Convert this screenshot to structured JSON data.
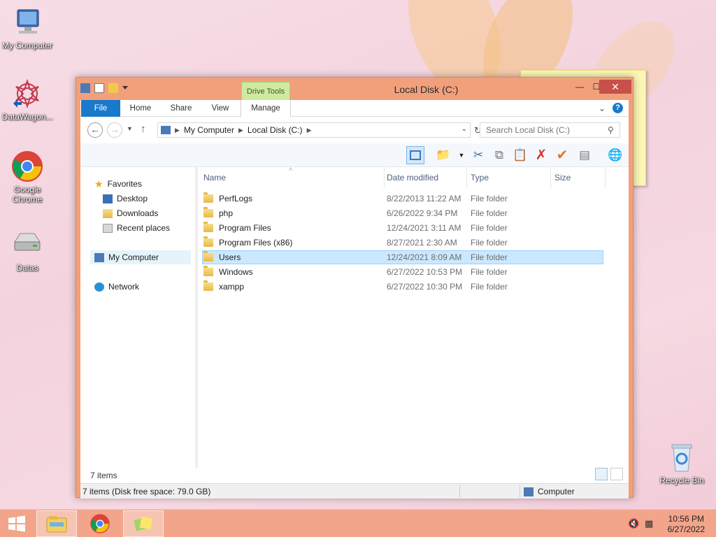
{
  "desktop": {
    "icons": [
      {
        "label": "My Computer"
      },
      {
        "label": "DataWagon..."
      },
      {
        "label": "Google Chrome"
      },
      {
        "label": "Datas"
      },
      {
        "label": "Recycle Bin"
      }
    ]
  },
  "window": {
    "title": "Local Disk (C:)",
    "contextual_tab": "Drive Tools",
    "ribbon_tabs": [
      "File",
      "Home",
      "Share",
      "View",
      "Manage"
    ],
    "address": {
      "segments": [
        "My Computer",
        "Local Disk (C:)"
      ]
    },
    "search_placeholder": "Search Local Disk (C:)",
    "nav": {
      "favorites": "Favorites",
      "desktop": "Desktop",
      "downloads": "Downloads",
      "recent": "Recent places",
      "computer": "My Computer",
      "network": "Network"
    },
    "columns": {
      "name": "Name",
      "date": "Date modified",
      "type": "Type",
      "size": "Size"
    },
    "files": [
      {
        "name": "PerfLogs",
        "date": "8/22/2013 11:22 AM",
        "type": "File folder"
      },
      {
        "name": "php",
        "date": "6/26/2022 9:34 PM",
        "type": "File folder"
      },
      {
        "name": "Program Files",
        "date": "12/24/2021 3:11 AM",
        "type": "File folder"
      },
      {
        "name": "Program Files (x86)",
        "date": "8/27/2021 2:30 AM",
        "type": "File folder"
      },
      {
        "name": "Users",
        "date": "12/24/2021 8:09 AM",
        "type": "File folder",
        "selected": true
      },
      {
        "name": "Windows",
        "date": "6/27/2022 10:53 PM",
        "type": "File folder"
      },
      {
        "name": "xampp",
        "date": "6/27/2022 10:30 PM",
        "type": "File folder"
      }
    ],
    "item_count": "7 items",
    "status_text": "7 items (Disk free space: 79.0 GB)",
    "status_location": "Computer"
  },
  "taskbar": {
    "time": "10:56 PM",
    "date": "6/27/2022"
  },
  "colors": {
    "window_frame": "#f1a07b",
    "file_tab": "#1979ca",
    "close_button": "#c7504a",
    "selection": "#cce8ff",
    "taskbar": "#f2a58a"
  }
}
